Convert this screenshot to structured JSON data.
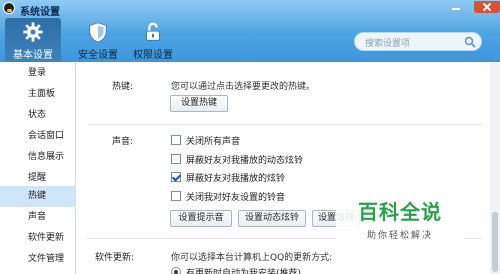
{
  "window": {
    "title": "系统设置"
  },
  "tabs": [
    {
      "label": "基本设置",
      "icon": "gear-icon"
    },
    {
      "label": "安全设置",
      "icon": "shield-icon"
    },
    {
      "label": "权限设置",
      "icon": "lock-icon"
    }
  ],
  "search": {
    "placeholder": "搜索设置项"
  },
  "sidebar": {
    "items": [
      "登录",
      "主面板",
      "状态",
      "会话窗口",
      "信息展示",
      "提醒",
      "热键",
      "声音",
      "软件更新",
      "文件管理"
    ],
    "active": "热键"
  },
  "hotkey": {
    "label": "热键:",
    "desc": "您可以通过点击选择要更改的热键。",
    "button": "设置热键"
  },
  "sound": {
    "label": "声音:",
    "options": [
      {
        "text": "关闭所有声音",
        "checked": false
      },
      {
        "text": "屏蔽好友对我播放的动态炫铃",
        "checked": false
      },
      {
        "text": "屏蔽好友对我播放的炫铃",
        "checked": true
      },
      {
        "text": "关闭我对好友设置的铃音",
        "checked": false
      }
    ],
    "buttons": [
      "设置提示音",
      "设置动态炫铃",
      "设置炫铃"
    ]
  },
  "update": {
    "label": "软件更新:",
    "desc": "你可以选择本台计算机上QQ的更新方式:",
    "option": "有更新时自动为我安装(推荐)"
  },
  "watermark": {
    "title": "百科全说",
    "subtitle": "助你轻松解决"
  },
  "colors": {
    "header": "#4ea3e3",
    "active_tab": "#2e6fa6",
    "sidebar_active": "#cfe6fa",
    "watermark": "#2aa14a"
  }
}
